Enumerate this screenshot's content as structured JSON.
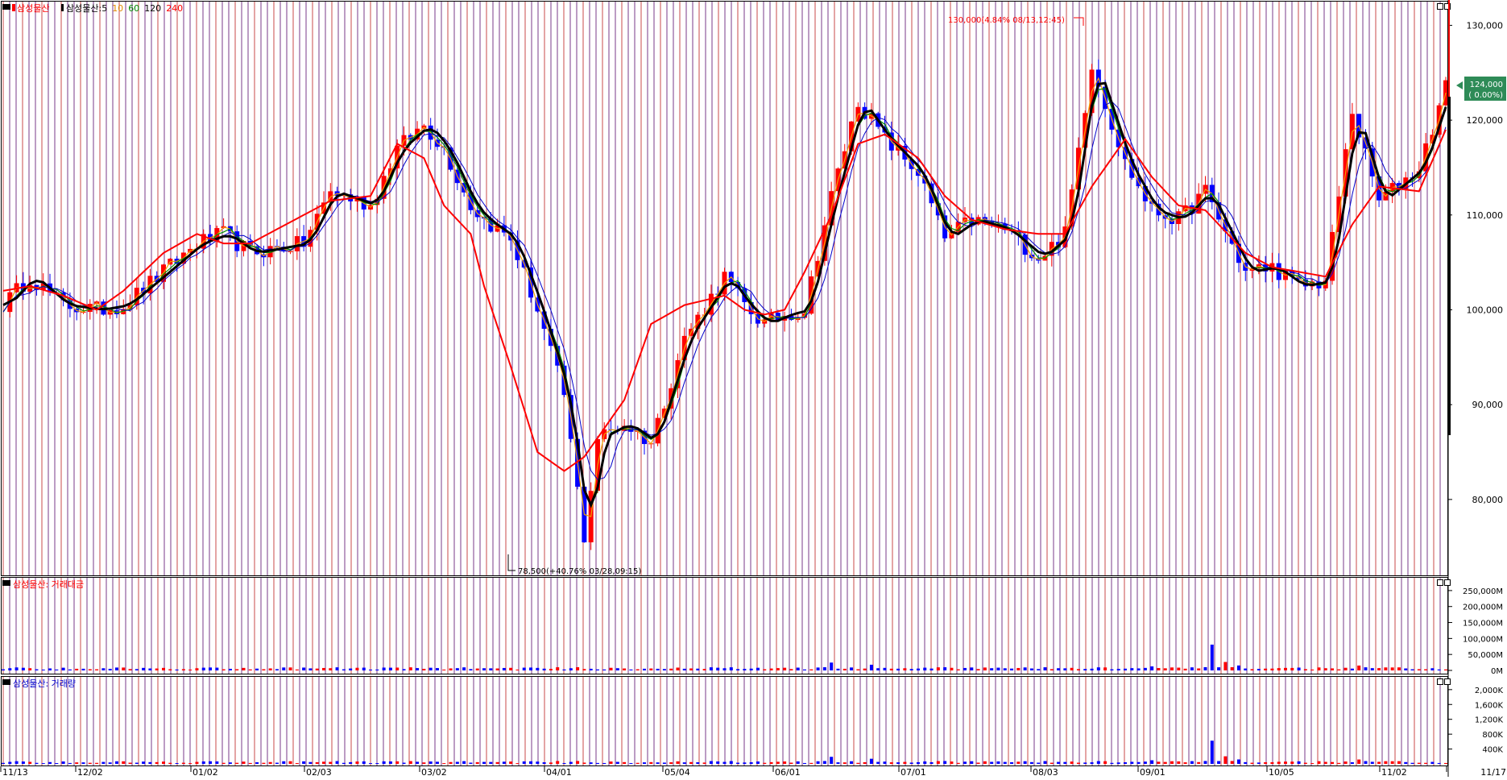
{
  "main_legend": {
    "stock": "삼성물산",
    "ma_prefix": "삼성물산:",
    "ma": [
      {
        "label": "5",
        "color": "#000000"
      },
      {
        "label": "10",
        "color": "#e08a00"
      },
      {
        "label": "60",
        "color": "#008800"
      },
      {
        "label": "120",
        "color": "#000000"
      },
      {
        "label": "240",
        "color": "#ff0000"
      }
    ]
  },
  "amount_legend": "삼성물산: 거래대금",
  "volume_legend": "삼성물산: 거래량",
  "current_price": {
    "value": "124,000",
    "change": "( 0.00%)"
  },
  "high_annotation": "130,000(4.84% 08/13,12:45)",
  "low_annotation": "78,500(+40.76% 03/28,09:15)",
  "colors": {
    "up": "#ff0000",
    "down": "#0000ff",
    "grid_a": "#7a3a8a",
    "grid_b": "#c84a4a",
    "ma_black": "#000000",
    "ma_red": "#ff0000",
    "ma_green": "#009000",
    "ma_orange": "#f0a000",
    "price_box": "#2e8b57"
  },
  "chart_data": [
    {
      "type": "line",
      "title": "",
      "x_ticks": [
        "11/13",
        "12/02",
        "01/02",
        "02/03",
        "03/02",
        "04/01",
        "05/04",
        "06/01",
        "07/01",
        "08/03",
        "09/01",
        "10/05",
        "11/02",
        "11/17"
      ],
      "y_ticks": [
        "130,000",
        "120,000",
        "110,000",
        "100,000",
        "90,000",
        "80,000"
      ],
      "ylim": [
        72000,
        132500
      ],
      "grid": true,
      "x_knots": [
        0,
        4,
        9,
        14,
        18,
        24,
        29,
        33,
        37,
        45,
        49,
        55,
        59,
        63,
        66,
        70,
        72,
        76,
        80,
        84,
        87,
        89,
        93,
        97,
        102,
        108,
        111,
        114,
        117,
        120,
        124,
        128,
        132,
        137,
        141,
        145,
        150,
        155,
        159,
        163,
        168,
        172,
        176,
        180,
        186,
        190,
        194,
        198,
        202,
        206,
        212,
        216
      ],
      "series": [
        {
          "name": "5",
          "values": [
            100500,
            103500,
            100500,
            100000,
            100500,
            104000,
            107000,
            108000,
            106000,
            107000,
            112500,
            111000,
            117000,
            119500,
            117000,
            111000,
            109500,
            107500,
            100000,
            91000,
            76000,
            86500,
            88000,
            86000,
            97000,
            103500,
            100500,
            98500,
            99500,
            100000,
            112000,
            122000,
            118000,
            114500,
            107500,
            109500,
            108500,
            105500,
            108000,
            126000,
            115500,
            110500,
            109500,
            112500,
            104000,
            104500,
            102500,
            103000,
            121000,
            111500,
            115000,
            123500
          ]
        },
        {
          "name": "240",
          "values": [
            102000,
            102500,
            101500,
            100000,
            102000,
            106000,
            108000,
            107000,
            107000,
            110000,
            111500,
            112000,
            117500,
            116000,
            111000,
            108000,
            102500,
            94000,
            85000,
            83000,
            84500,
            86500,
            90500,
            98500,
            100500,
            101500,
            100000,
            99500,
            100000,
            104000,
            110000,
            117500,
            118500,
            116000,
            112000,
            109500,
            108500,
            108000,
            108000,
            113000,
            118000,
            114000,
            111000,
            110500,
            106000,
            104500,
            104000,
            103500,
            109000,
            113000,
            112500,
            119000
          ]
        }
      ]
    },
    {
      "type": "bar",
      "name": "거래대금",
      "y_ticks": [
        "250,000M",
        "200,000M",
        "150,000M",
        "100,000M",
        "50,000M",
        "0M"
      ],
      "ylim": [
        0,
        280000
      ]
    },
    {
      "type": "bar",
      "name": "거래량",
      "y_ticks": [
        "2,000K",
        "1,600K",
        "1,200K",
        "800K",
        "400K"
      ],
      "ylim": [
        0,
        2300
      ]
    }
  ]
}
